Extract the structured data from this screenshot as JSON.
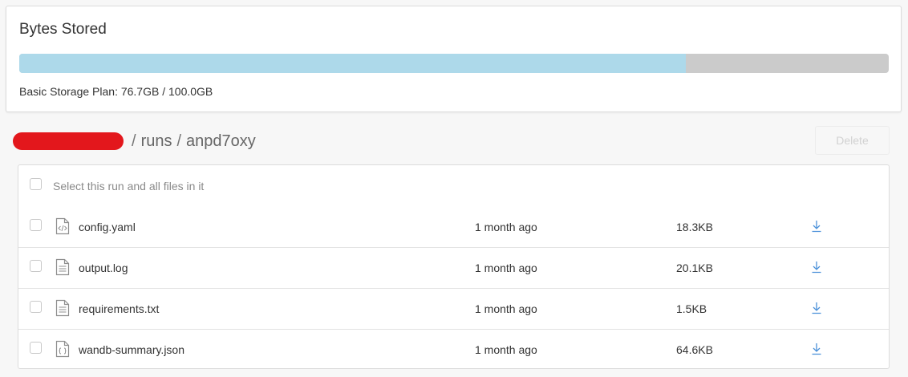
{
  "storage": {
    "title": "Bytes Stored",
    "used_fraction": 0.767,
    "caption": "Basic Storage Plan: 76.7GB / 100.0GB",
    "colors": {
      "fill": "#add9ea",
      "track": "#cbcbcb"
    }
  },
  "breadcrumb": {
    "owner_redacted": true,
    "sep1": "/",
    "section": "runs",
    "sep2": "/",
    "run_id": "anpd7oxy"
  },
  "actions": {
    "delete_label": "Delete"
  },
  "files": {
    "select_all_label": "Select this run and all files in it",
    "rows": [
      {
        "name": "config.yaml",
        "icon": "code-file-icon",
        "modified": "1 month ago",
        "size": "18.3KB"
      },
      {
        "name": "output.log",
        "icon": "text-file-icon",
        "modified": "1 month ago",
        "size": "20.1KB"
      },
      {
        "name": "requirements.txt",
        "icon": "text-file-icon",
        "modified": "1 month ago",
        "size": "1.5KB"
      },
      {
        "name": "wandb-summary.json",
        "icon": "json-file-icon",
        "modified": "1 month ago",
        "size": "64.6KB"
      }
    ]
  }
}
